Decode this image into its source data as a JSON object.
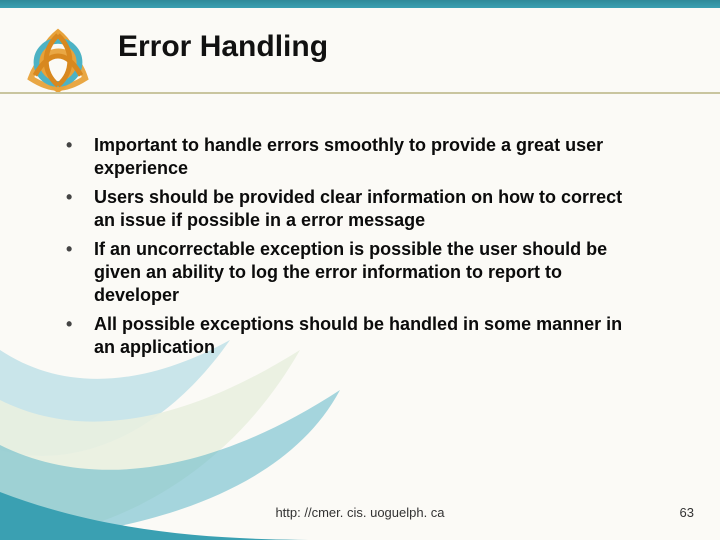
{
  "title": "Error Handling",
  "bullets": [
    "Important to handle errors smoothly to provide a great user experience",
    "Users should be provided clear information on how to correct an issue if possible in a error message",
    "If an uncorrectable exception is possible the user should be given an ability to log the error information to report to developer",
    "All possible exceptions should be handled in some manner in an application"
  ],
  "footer_url": "http: //cmer. cis. uoguelph. ca",
  "page_number": "63",
  "colors": {
    "accent_teal": "#3aa0b2",
    "accent_orange": "#e08a1f",
    "divider": "#c9c59f"
  },
  "icons": {
    "logo": "triquetra-knot-icon"
  }
}
